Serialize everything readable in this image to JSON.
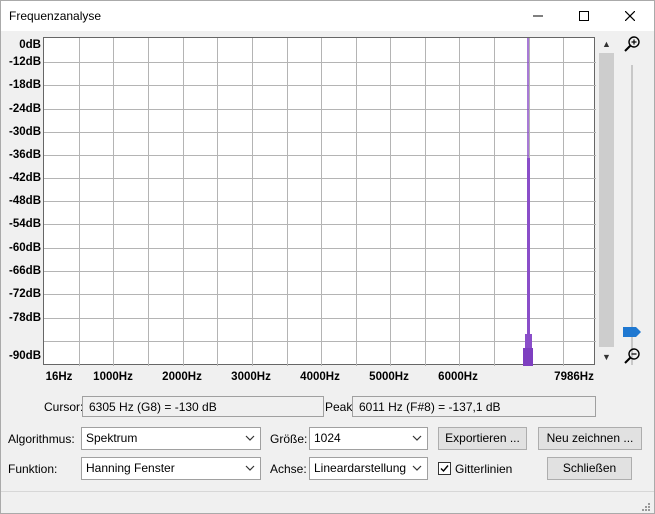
{
  "window": {
    "title": "Frequenzanalyse"
  },
  "plot": {
    "y_tick_labels": [
      "0dB",
      "-12dB",
      "-18dB",
      "-24dB",
      "-30dB",
      "-36dB",
      "-42dB",
      "-48dB",
      "-54dB",
      "-60dB",
      "-66dB",
      "-72dB",
      "-78dB",
      "-90dB"
    ],
    "x_tick_labels": [
      "16Hz",
      "1000Hz",
      "2000Hz",
      "3000Hz",
      "4000Hz",
      "5000Hz",
      "6000Hz",
      "7986Hz"
    ],
    "line_color": "#8a4ec9",
    "grid": true
  },
  "readouts": {
    "cursor_label": "Cursor:",
    "cursor_value": "6305 Hz (G8) = -130 dB",
    "peak_label": "Peak:",
    "peak_value": "6011 Hz (F#8) = -137,1 dB"
  },
  "controls": {
    "algorithm_label": "Algorithmus:",
    "algorithm_value": "Spektrum",
    "size_label": "Größe:",
    "size_value": "1024",
    "function_label": "Funktion:",
    "function_value": "Hanning Fenster",
    "axis_label": "Achse:",
    "axis_value": "Lineardarstellung",
    "gridlines_label": "Gitterlinien",
    "gridlines_checked": true,
    "export_label": "Exportieren ...",
    "redraw_label": "Neu zeichnen ...",
    "close_label": "Schließen"
  }
}
